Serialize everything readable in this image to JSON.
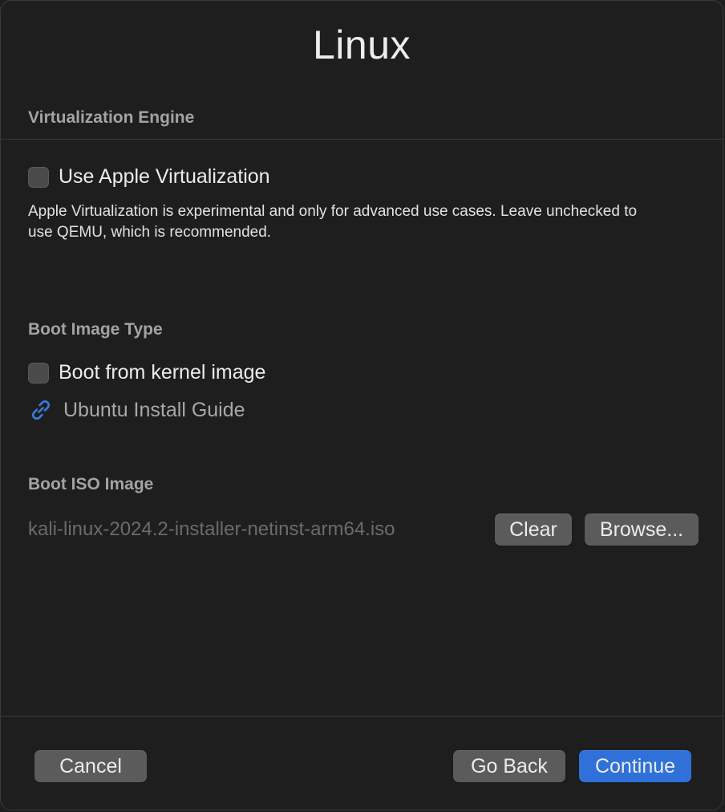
{
  "window": {
    "title": "Linux"
  },
  "virtualization": {
    "header": "Virtualization Engine",
    "checkbox_label": "Use Apple Virtualization",
    "checked": false,
    "description": "Apple Virtualization is experimental and only for advanced use cases. Leave unchecked to use QEMU, which is recommended."
  },
  "boot_type": {
    "header": "Boot Image Type",
    "checkbox_label": "Boot from kernel image",
    "checked": false,
    "link_icon": "link-icon",
    "link_label": "Ubuntu Install Guide"
  },
  "boot_iso": {
    "header": "Boot ISO Image",
    "path": "kali-linux-2024.2-installer-netinst-arm64.iso",
    "clear_label": "Clear",
    "browse_label": "Browse..."
  },
  "footer": {
    "cancel_label": "Cancel",
    "go_back_label": "Go Back",
    "continue_label": "Continue"
  },
  "colors": {
    "background": "#1e1e1e",
    "accent": "#2f71d8",
    "button": "#5b5b5b",
    "link_icon": "#3b7de0"
  }
}
